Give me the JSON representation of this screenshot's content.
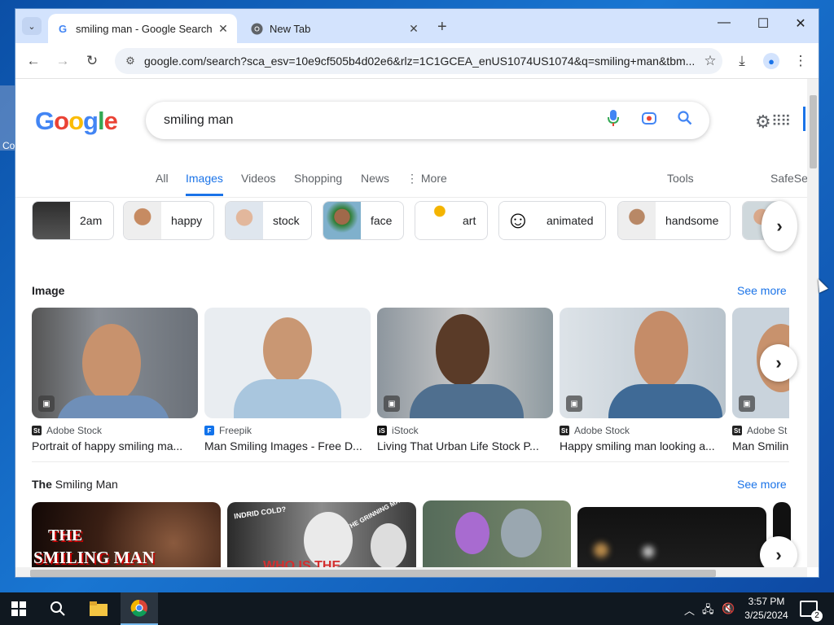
{
  "desktop": {
    "icon_label": "Co"
  },
  "browser": {
    "tabs": [
      {
        "title": "smiling man - Google Search",
        "favicon": "G"
      },
      {
        "title": "New Tab",
        "favicon": "chrome-icon"
      }
    ],
    "url": "google.com/search?sca_esv=10e9cf505b4d02e6&rlz=1C1GCEA_enUS1074US1074&q=smiling+man&tbm..."
  },
  "google": {
    "logo": [
      "G",
      "o",
      "o",
      "g",
      "l",
      "e"
    ],
    "logo_colors": [
      "#4285F4",
      "#EA4335",
      "#FBBC05",
      "#4285F4",
      "#34A853",
      "#EA4335"
    ],
    "query": "smiling man",
    "nav": [
      "All",
      "Images",
      "Videos",
      "Shopping",
      "News",
      "More",
      "Tools",
      "SafeSe"
    ],
    "chips": [
      "2am",
      "happy",
      "stock",
      "face",
      "art",
      "animated",
      "handsome"
    ],
    "section1": {
      "title": "Image",
      "see_more": "See more"
    },
    "images": [
      {
        "source": "Adobe Stock",
        "caption": "Portrait of happy smiling ma..."
      },
      {
        "source": "Freepik",
        "caption": "Man Smiling Images - Free D..."
      },
      {
        "source": "iStock",
        "caption": "Living That Urban Life Stock P..."
      },
      {
        "source": "Adobe Stock",
        "caption": "Happy smiling man looking a..."
      },
      {
        "source": "Adobe St",
        "caption": "Man Smilin"
      }
    ],
    "section2": {
      "title_bold": "The",
      "title_rest": " Smiling Man",
      "see_more": "See more"
    },
    "video_texts": {
      "v1_line1": "THE",
      "v1_line2": "SMILING MAN",
      "v2_a": "INDRID COLD?",
      "v2_b": "THE GRINNING MAN?",
      "v2_c": "WHO IS THE"
    }
  },
  "taskbar": {
    "time": "3:57 PM",
    "date": "3/25/2024",
    "notifications": "2"
  }
}
